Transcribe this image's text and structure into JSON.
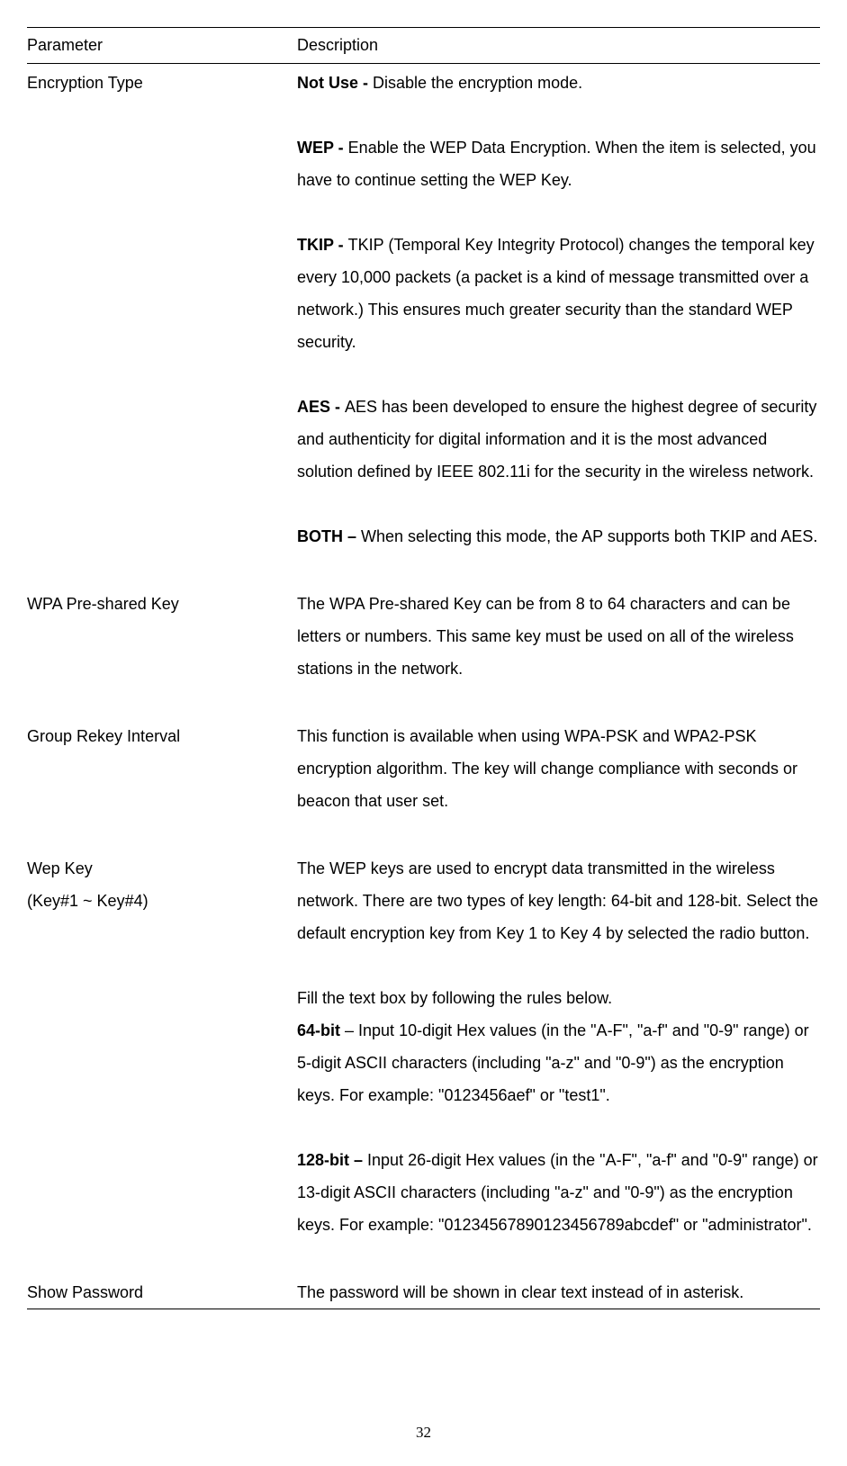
{
  "table": {
    "header_parameter": "Parameter",
    "header_description": "Description",
    "rows": {
      "encryption_type": {
        "param": "Encryption Type",
        "not_use_label": "Not Use - ",
        "not_use_text": "Disable the encryption mode.",
        "wep_label": "WEP - ",
        "wep_text": "Enable the WEP Data Encryption. When the item is selected, you have to continue setting the WEP Key.",
        "tkip_label": "TKIP - ",
        "tkip_text": "TKIP (Temporal Key Integrity Protocol) changes the temporal key every 10,000 packets (a packet is a kind of message transmitted over a network.) This ensures much greater security than the standard WEP security.",
        "aes_label": "AES - ",
        "aes_text": "AES has been developed to ensure the highest degree of security and authenticity for digital information and it is the most advanced solution defined by IEEE 802.11i for the security in the wireless network.",
        "both_label": "BOTH – ",
        "both_text": "When selecting this mode, the AP supports both TKIP and AES."
      },
      "wpa_psk": {
        "param": "WPA Pre-shared Key",
        "text": "The WPA Pre-shared Key can be from 8 to 64 characters and can be letters or numbers. This same key must be used on all of the wireless stations in the network."
      },
      "group_rekey": {
        "param": "Group Rekey Interval",
        "text": "This function is available when using WPA-PSK and WPA2-PSK encryption algorithm. The key will change compliance with seconds or beacon that user set."
      },
      "wep_key": {
        "param_line1": "Wep Key",
        "param_line2": "(Key#1 ~ Key#4)",
        "intro": "The WEP keys are used to encrypt data transmitted in the wireless network. There are two types of key length: 64-bit and 128-bit. Select the default encryption key from Key 1 to Key 4 by selected the radio button.",
        "fill_rules": "Fill the text box by following the rules below.",
        "bit64_label": "64-bit",
        "bit64_text": " – Input 10-digit Hex values (in the \"A-F\", \"a-f\" and \"0-9\" range) or 5-digit ASCII characters (including \"a-z\" and \"0-9\") as the encryption keys. For example: \"0123456aef\" or \"test1\".",
        "bit128_label": "128-bit – ",
        "bit128_text": "Input 26-digit Hex values (in the \"A-F\", \"a-f\" and \"0-9\" range) or 13-digit ASCII characters (including \"a-z\" and \"0-9\") as the encryption keys. For example: \"01234567890123456789abcdef\" or \"administrator\"."
      },
      "show_password": {
        "param": "Show Password",
        "text": "The password will be shown in clear text instead of in asterisk."
      }
    }
  },
  "page_number": "32"
}
